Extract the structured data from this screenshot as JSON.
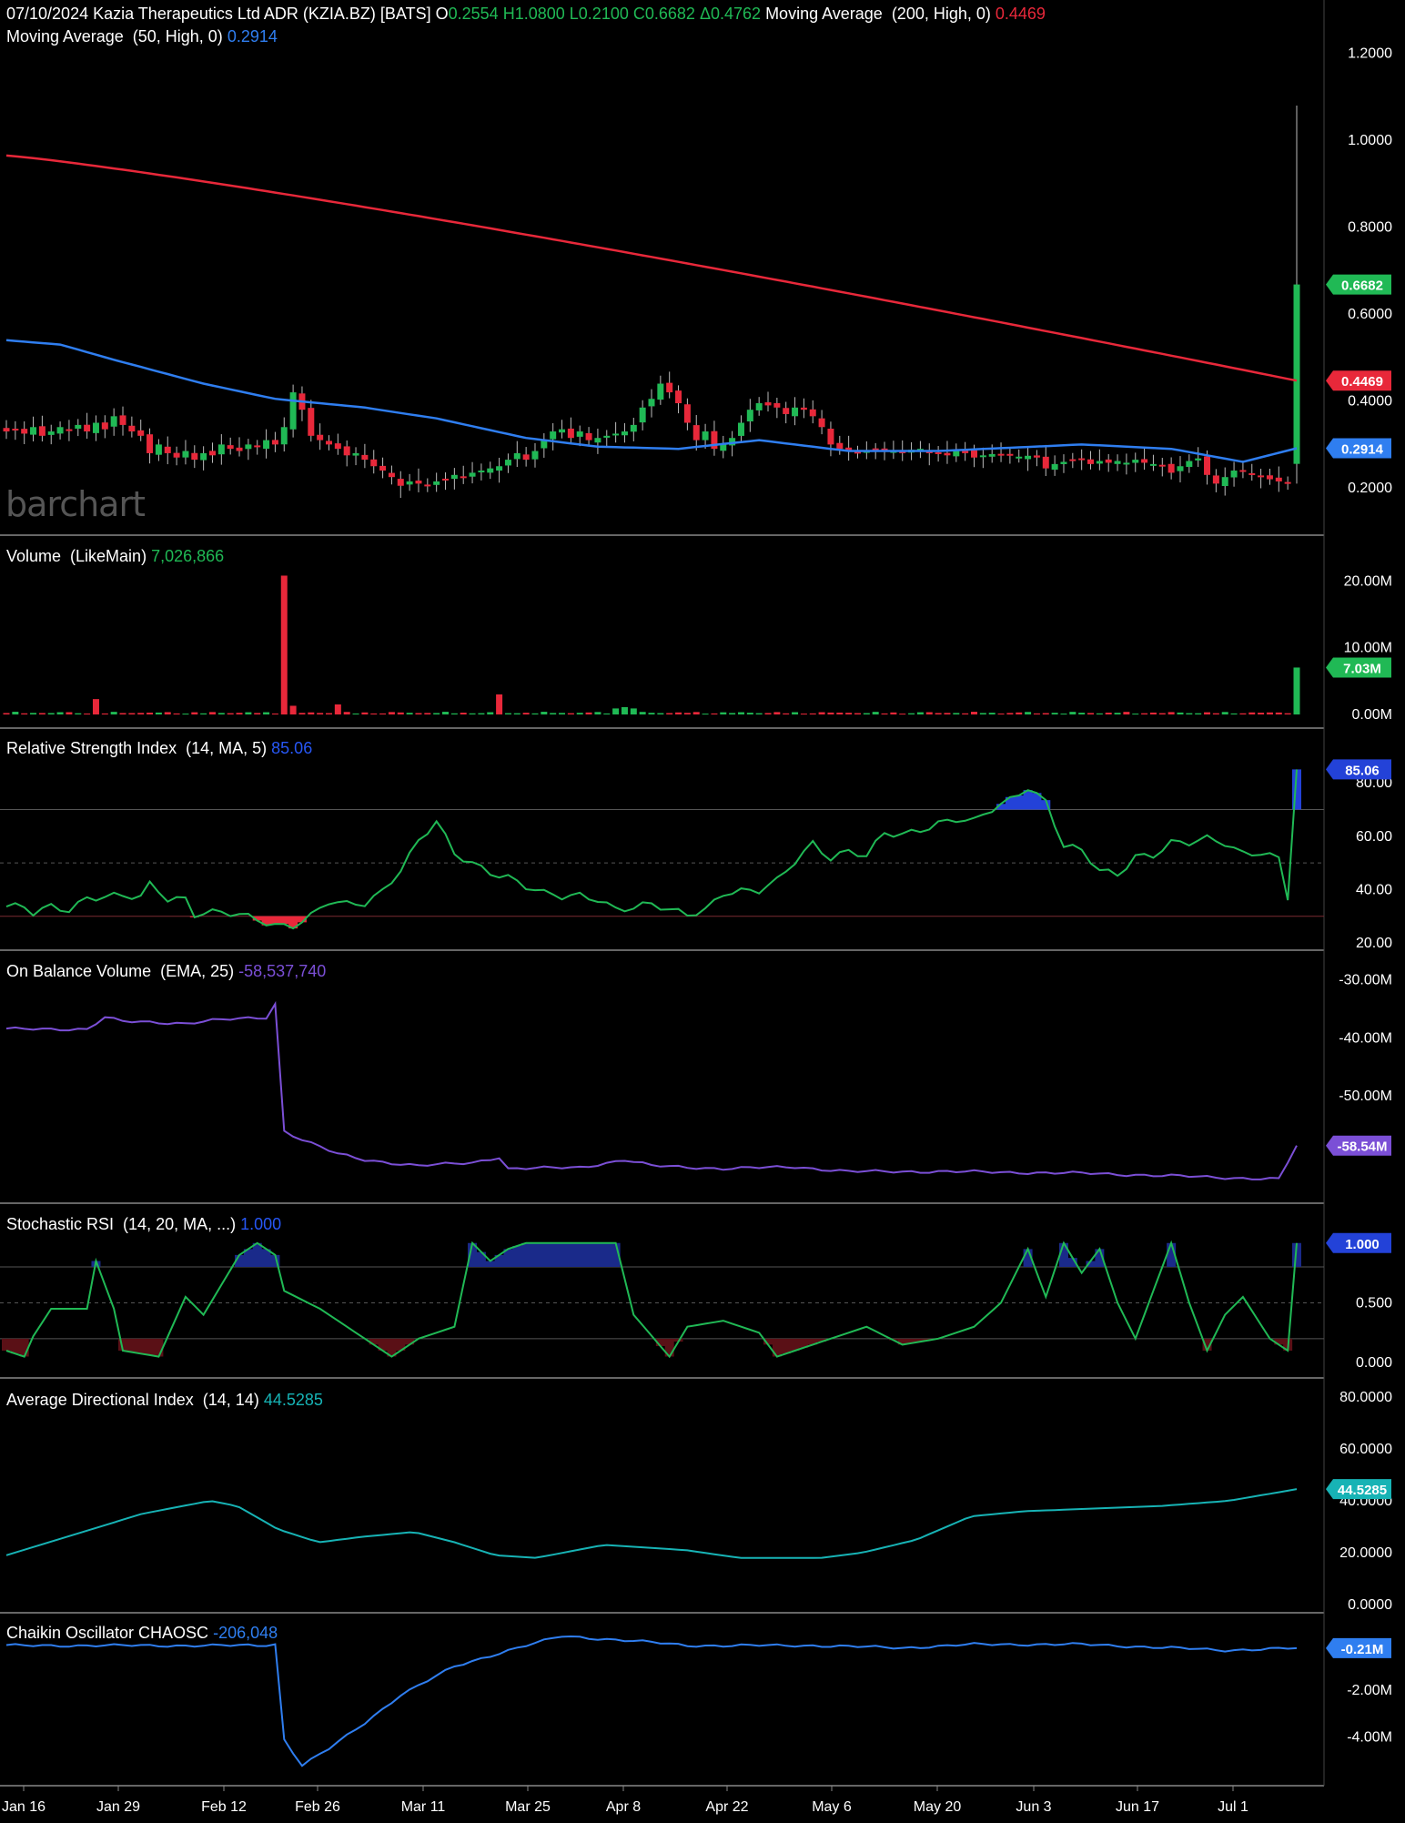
{
  "header": {
    "date": "07/10/2024",
    "instrument": "Kazia Therapeutics Ltd ADR (KZIA.BZ) [BATS]",
    "open_label": "O",
    "open": "0.2554",
    "high_label": "H",
    "high": "1.0800",
    "low_label": "L",
    "low": "0.2100",
    "close_label": "C",
    "close": "0.6682",
    "change_label": "Δ",
    "change": "0.4762",
    "ma200_label": "Moving Average  (200, High, 0)",
    "ma200_value": "0.4469",
    "ma50_label": "Moving Average  (50, High, 0)",
    "ma50_value": "0.2914"
  },
  "logo": "barchart",
  "colors": {
    "up": "#20b955",
    "down": "#e8283a",
    "ma200": "#e8283a",
    "ma50": "#2f7ef0",
    "rsi": "#20b955",
    "obv": "#7b4fd6",
    "adx": "#17b3b5",
    "chaikin": "#2f7ef0",
    "overbought_fill": "#2342d8",
    "oversold_fill": "#e8283a"
  },
  "x_axis": [
    "Jan 16",
    "Jan 29",
    "Feb 12",
    "Feb 26",
    "Mar 11",
    "Mar 25",
    "Apr 8",
    "Apr 22",
    "May 6",
    "May 20",
    "Jun 3",
    "Jun 17",
    "Jul 1"
  ],
  "chart_data": [
    {
      "type": "candlestick",
      "panel": "price",
      "y_ticks": [
        "1.2000",
        "1.0000",
        "0.8000",
        "0.6000",
        "0.4000",
        "0.2000"
      ],
      "ylim": [
        0.15,
        1.26
      ],
      "badges": [
        {
          "text": "0.6682",
          "value": 0.6682,
          "color": "#20b955"
        },
        {
          "text": "0.4469",
          "value": 0.4469,
          "color": "#e8283a"
        },
        {
          "text": "0.2914",
          "value": 0.2914,
          "color": "#2f7ef0"
        }
      ],
      "closes": [
        0.33,
        0.335,
        0.325,
        0.34,
        0.32,
        0.33,
        0.34,
        0.335,
        0.345,
        0.33,
        0.35,
        0.335,
        0.365,
        0.345,
        0.33,
        0.32,
        0.28,
        0.3,
        0.28,
        0.27,
        0.285,
        0.265,
        0.28,
        0.275,
        0.3,
        0.29,
        0.285,
        0.3,
        0.295,
        0.31,
        0.3,
        0.34,
        0.42,
        0.38,
        0.32,
        0.31,
        0.3,
        0.29,
        0.275,
        0.28,
        0.265,
        0.25,
        0.24,
        0.225,
        0.205,
        0.215,
        0.21,
        0.205,
        0.215,
        0.22,
        0.23,
        0.225,
        0.235,
        0.24,
        0.245,
        0.25,
        0.265,
        0.28,
        0.265,
        0.285,
        0.31,
        0.33,
        0.335,
        0.315,
        0.33,
        0.31,
        0.315,
        0.32,
        0.325,
        0.33,
        0.345,
        0.385,
        0.405,
        0.44,
        0.42,
        0.395,
        0.35,
        0.31,
        0.33,
        0.29,
        0.3,
        0.315,
        0.35,
        0.38,
        0.395,
        0.39,
        0.385,
        0.37,
        0.385,
        0.38,
        0.365,
        0.34,
        0.3,
        0.29,
        0.285,
        0.28,
        0.285,
        0.29,
        0.288,
        0.285,
        0.28,
        0.288,
        0.29,
        0.28,
        0.278,
        0.275,
        0.285,
        0.28,
        0.27,
        0.275,
        0.278,
        0.276,
        0.275,
        0.272,
        0.274,
        0.27,
        0.245,
        0.255,
        0.26,
        0.265,
        0.268,
        0.255,
        0.262,
        0.258,
        0.262,
        0.258,
        0.265,
        0.258,
        0.255,
        0.25,
        0.235,
        0.25,
        0.262,
        0.268,
        0.23,
        0.21,
        0.225,
        0.24,
        0.238,
        0.232,
        0.225,
        0.22,
        0.215,
        0.21,
        0.6682
      ],
      "series": [
        {
          "name": "Moving Average  (200, High, 0)",
          "start": 0.965,
          "end": 0.4469
        },
        {
          "name": "Moving Average  (50, High, 0)",
          "points": [
            [
              0,
              0.54
            ],
            [
              6,
              0.53
            ],
            [
              12,
              0.495
            ],
            [
              22,
              0.44
            ],
            [
              30,
              0.405
            ],
            [
              40,
              0.385
            ],
            [
              48,
              0.36
            ],
            [
              58,
              0.315
            ],
            [
              66,
              0.295
            ],
            [
              75,
              0.29
            ],
            [
              84,
              0.31
            ],
            [
              94,
              0.285
            ],
            [
              104,
              0.285
            ],
            [
              120,
              0.3
            ],
            [
              130,
              0.29
            ],
            [
              138,
              0.26
            ],
            [
              144,
              0.2914
            ]
          ]
        }
      ]
    },
    {
      "type": "bar",
      "panel": "volume",
      "title": "Volume  (LikeMain)",
      "value_text": "7,026,866",
      "y_ticks": [
        "20.00M",
        "10.00M",
        "0.00M"
      ],
      "ylim": [
        0,
        22.5
      ],
      "badge": {
        "text": "7.03M",
        "value": 7.03
      },
      "spikes": [
        [
          10,
          2.3,
          "down"
        ],
        [
          31,
          20.8,
          "down"
        ],
        [
          32,
          1.3,
          "down"
        ],
        [
          37,
          1.5,
          "down"
        ],
        [
          55,
          3.0,
          "down"
        ],
        [
          68,
          0.9,
          "up"
        ],
        [
          69,
          1.1,
          "up"
        ],
        [
          70,
          0.9,
          "up"
        ],
        [
          144,
          7.03,
          "up"
        ]
      ]
    },
    {
      "type": "line",
      "panel": "rsi",
      "title": "Relative Strength Index  (14, MA, 5)",
      "value_text": "85.06",
      "y_ticks": [
        "80.00",
        "60.00",
        "40.00",
        "20.00"
      ],
      "ylim": [
        20,
        91
      ],
      "levels": [
        70,
        50,
        30
      ],
      "badge": {
        "text": "85.06",
        "value": 85.06
      },
      "points": [
        [
          0,
          33
        ],
        [
          2,
          33
        ],
        [
          3,
          31
        ],
        [
          5,
          34
        ],
        [
          7,
          33
        ],
        [
          9,
          37
        ],
        [
          13,
          37
        ],
        [
          14,
          37
        ],
        [
          15,
          37
        ],
        [
          16,
          42
        ],
        [
          18,
          37
        ],
        [
          20,
          37
        ],
        [
          21,
          31
        ],
        [
          23,
          31
        ],
        [
          24,
          31
        ],
        [
          26,
          30
        ],
        [
          17,
          40
        ],
        [
          28,
          29
        ],
        [
          30,
          27
        ],
        [
          32,
          27
        ],
        [
          34,
          30
        ],
        [
          36,
          35
        ],
        [
          38,
          34
        ],
        [
          40,
          35
        ],
        [
          42,
          40
        ],
        [
          44,
          48
        ],
        [
          46,
          58
        ],
        [
          48,
          65
        ],
        [
          50,
          53
        ],
        [
          52,
          50
        ],
        [
          54,
          47
        ],
        [
          56,
          45
        ],
        [
          58,
          41
        ],
        [
          60,
          38
        ],
        [
          62,
          37
        ],
        [
          64,
          38
        ],
        [
          66,
          37
        ],
        [
          68,
          33
        ],
        [
          70,
          33
        ],
        [
          72,
          34
        ],
        [
          74,
          32
        ],
        [
          76,
          31
        ],
        [
          78,
          33
        ],
        [
          80,
          39
        ],
        [
          82,
          39
        ],
        [
          84,
          39
        ],
        [
          86,
          43
        ],
        [
          88,
          51
        ],
        [
          90,
          58
        ],
        [
          92,
          52
        ],
        [
          94,
          54
        ],
        [
          96,
          52
        ],
        [
          98,
          61
        ],
        [
          100,
          61
        ],
        [
          102,
          63
        ],
        [
          104,
          65
        ],
        [
          106,
          66
        ],
        [
          108,
          65
        ],
        [
          110,
          70
        ],
        [
          112,
          74
        ],
        [
          114,
          79
        ],
        [
          116,
          73
        ],
        [
          118,
          56
        ],
        [
          120,
          54
        ],
        [
          122,
          47
        ],
        [
          124,
          46
        ],
        [
          126,
          53
        ],
        [
          128,
          53
        ],
        [
          130,
          57
        ],
        [
          132,
          57
        ],
        [
          134,
          59
        ],
        [
          136,
          58
        ],
        [
          138,
          54
        ],
        [
          140,
          54
        ],
        [
          142,
          51
        ],
        [
          144,
          47
        ]
      ]
    },
    {
      "type": "line",
      "panel": "obv",
      "title": "On Balance Volume  (EMA, 25)",
      "value_text": "-58,537,740",
      "y_ticks": [
        "-30.00M",
        "-40.00M",
        "-50.00M"
      ],
      "ylim": [
        -65,
        -29
      ],
      "badge": {
        "text": "-58.54M",
        "value": -58.54
      }
    },
    {
      "type": "line",
      "panel": "stochrsi",
      "title": "Stochastic RSI  (14, 20, MA, ...)",
      "value_text": "1.000",
      "y_ticks": [
        "0.500",
        "0.000"
      ],
      "ylim": [
        -0.06,
        1.12
      ],
      "levels": [
        0.8,
        0.5,
        0.2
      ],
      "badge": {
        "text": "1.000",
        "value": 1.0
      }
    },
    {
      "type": "line",
      "panel": "adx",
      "title": "Average Directional Index  (14, 14)",
      "value_text": "44.5285",
      "y_ticks": [
        "80.0000",
        "60.0000",
        "40.0000",
        "20.0000",
        "0.0000"
      ],
      "ylim": [
        0,
        80
      ],
      "badge": {
        "text": "44.5285",
        "value": 44.5285
      }
    },
    {
      "type": "line",
      "panel": "chaikin",
      "title": "Chaikin Oscillator CHAOSC",
      "value_text": "-206,048",
      "y_ticks": [
        "-2.00M",
        "-4.00M"
      ],
      "ylim": [
        -5.8,
        0.6
      ],
      "badge": {
        "text": "-0.21M",
        "value": -0.21
      }
    }
  ]
}
